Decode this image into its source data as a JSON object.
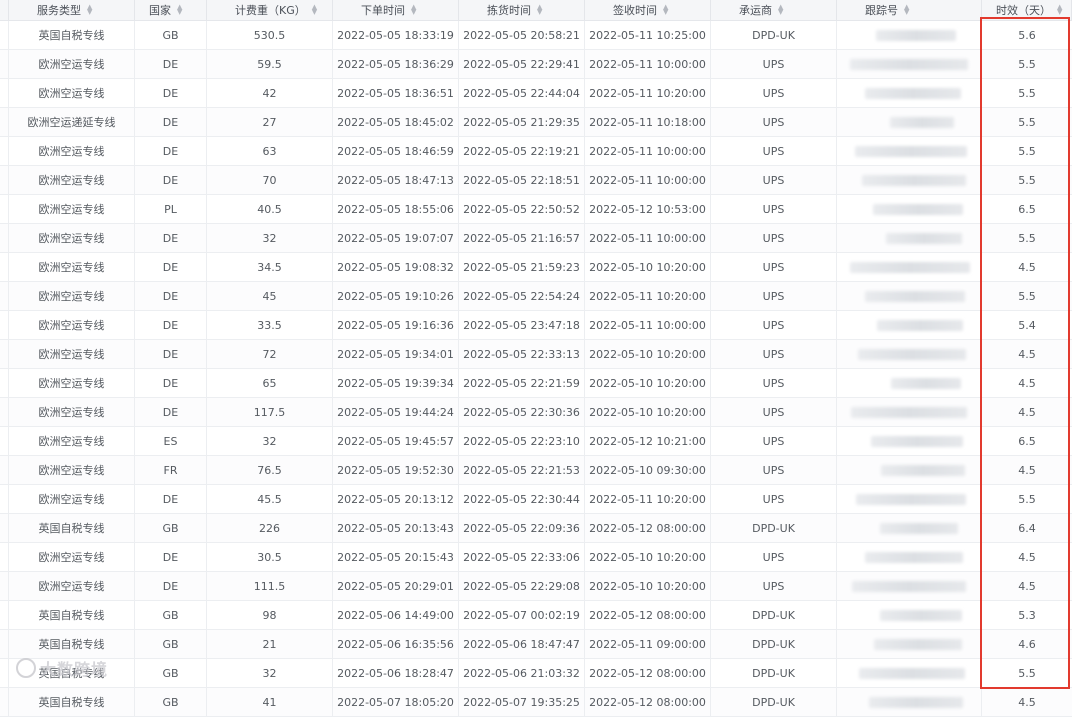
{
  "columns": [
    {
      "label": "服务类型"
    },
    {
      "label": "国家"
    },
    {
      "label": "计费重（KG）"
    },
    {
      "label": "下单时间"
    },
    {
      "label": "拣货时间"
    },
    {
      "label": "签收时间"
    },
    {
      "label": "承运商"
    },
    {
      "label": "跟踪号"
    },
    {
      "label": "时效（天）"
    }
  ],
  "rows": [
    {
      "service": "英国自税专线",
      "country": "GB",
      "weight": "530.5",
      "order_time": "2022-05-05 18:33:19",
      "pick_time": "2022-05-05 20:58:21",
      "sign_time": "2022-05-11 10:25:00",
      "carrier": "DPD-UK",
      "tracking": "",
      "days": "5.6"
    },
    {
      "service": "欧洲空运专线",
      "country": "DE",
      "weight": "59.5",
      "order_time": "2022-05-05 18:36:29",
      "pick_time": "2022-05-05 22:29:41",
      "sign_time": "2022-05-11 10:00:00",
      "carrier": "UPS",
      "tracking": "",
      "days": "5.5"
    },
    {
      "service": "欧洲空运专线",
      "country": "DE",
      "weight": "42",
      "order_time": "2022-05-05 18:36:51",
      "pick_time": "2022-05-05 22:44:04",
      "sign_time": "2022-05-11 10:20:00",
      "carrier": "UPS",
      "tracking": "",
      "days": "5.5"
    },
    {
      "service": "欧洲空运递延专线",
      "country": "DE",
      "weight": "27",
      "order_time": "2022-05-05 18:45:02",
      "pick_time": "2022-05-05 21:29:35",
      "sign_time": "2022-05-11 10:18:00",
      "carrier": "UPS",
      "tracking": "",
      "days": "5.5"
    },
    {
      "service": "欧洲空运专线",
      "country": "DE",
      "weight": "63",
      "order_time": "2022-05-05 18:46:59",
      "pick_time": "2022-05-05 22:19:21",
      "sign_time": "2022-05-11 10:00:00",
      "carrier": "UPS",
      "tracking": "",
      "days": "5.5"
    },
    {
      "service": "欧洲空运专线",
      "country": "DE",
      "weight": "70",
      "order_time": "2022-05-05 18:47:13",
      "pick_time": "2022-05-05 22:18:51",
      "sign_time": "2022-05-11 10:00:00",
      "carrier": "UPS",
      "tracking": "",
      "days": "5.5"
    },
    {
      "service": "欧洲空运专线",
      "country": "PL",
      "weight": "40.5",
      "order_time": "2022-05-05 18:55:06",
      "pick_time": "2022-05-05 22:50:52",
      "sign_time": "2022-05-12 10:53:00",
      "carrier": "UPS",
      "tracking": "",
      "days": "6.5"
    },
    {
      "service": "欧洲空运专线",
      "country": "DE",
      "weight": "32",
      "order_time": "2022-05-05 19:07:07",
      "pick_time": "2022-05-05 21:16:57",
      "sign_time": "2022-05-11 10:00:00",
      "carrier": "UPS",
      "tracking": "",
      "days": "5.5"
    },
    {
      "service": "欧洲空运专线",
      "country": "DE",
      "weight": "34.5",
      "order_time": "2022-05-05 19:08:32",
      "pick_time": "2022-05-05 21:59:23",
      "sign_time": "2022-05-10 10:20:00",
      "carrier": "UPS",
      "tracking": "",
      "days": "4.5"
    },
    {
      "service": "欧洲空运专线",
      "country": "DE",
      "weight": "45",
      "order_time": "2022-05-05 19:10:26",
      "pick_time": "2022-05-05 22:54:24",
      "sign_time": "2022-05-11 10:20:00",
      "carrier": "UPS",
      "tracking": "",
      "days": "5.5"
    },
    {
      "service": "欧洲空运专线",
      "country": "DE",
      "weight": "33.5",
      "order_time": "2022-05-05 19:16:36",
      "pick_time": "2022-05-05 23:47:18",
      "sign_time": "2022-05-11 10:00:00",
      "carrier": "UPS",
      "tracking": "",
      "days": "5.4"
    },
    {
      "service": "欧洲空运专线",
      "country": "DE",
      "weight": "72",
      "order_time": "2022-05-05 19:34:01",
      "pick_time": "2022-05-05 22:33:13",
      "sign_time": "2022-05-10 10:20:00",
      "carrier": "UPS",
      "tracking": "",
      "days": "4.5"
    },
    {
      "service": "欧洲空运专线",
      "country": "DE",
      "weight": "65",
      "order_time": "2022-05-05 19:39:34",
      "pick_time": "2022-05-05 22:21:59",
      "sign_time": "2022-05-10 10:20:00",
      "carrier": "UPS",
      "tracking": "",
      "days": "4.5"
    },
    {
      "service": "欧洲空运专线",
      "country": "DE",
      "weight": "117.5",
      "order_time": "2022-05-05 19:44:24",
      "pick_time": "2022-05-05 22:30:36",
      "sign_time": "2022-05-10 10:20:00",
      "carrier": "UPS",
      "tracking": "",
      "days": "4.5"
    },
    {
      "service": "欧洲空运专线",
      "country": "ES",
      "weight": "32",
      "order_time": "2022-05-05 19:45:57",
      "pick_time": "2022-05-05 22:23:10",
      "sign_time": "2022-05-12 10:21:00",
      "carrier": "UPS",
      "tracking": "",
      "days": "6.5"
    },
    {
      "service": "欧洲空运专线",
      "country": "FR",
      "weight": "76.5",
      "order_time": "2022-05-05 19:52:30",
      "pick_time": "2022-05-05 22:21:53",
      "sign_time": "2022-05-10 09:30:00",
      "carrier": "UPS",
      "tracking": "",
      "days": "4.5"
    },
    {
      "service": "欧洲空运专线",
      "country": "DE",
      "weight": "45.5",
      "order_time": "2022-05-05 20:13:12",
      "pick_time": "2022-05-05 22:30:44",
      "sign_time": "2022-05-11 10:20:00",
      "carrier": "UPS",
      "tracking": "",
      "days": "5.5"
    },
    {
      "service": "英国自税专线",
      "country": "GB",
      "weight": "226",
      "order_time": "2022-05-05 20:13:43",
      "pick_time": "2022-05-05 22:09:36",
      "sign_time": "2022-05-12 08:00:00",
      "carrier": "DPD-UK",
      "tracking": "",
      "days": "6.4"
    },
    {
      "service": "欧洲空运专线",
      "country": "DE",
      "weight": "30.5",
      "order_time": "2022-05-05 20:15:43",
      "pick_time": "2022-05-05 22:33:06",
      "sign_time": "2022-05-10 10:20:00",
      "carrier": "UPS",
      "tracking": "",
      "days": "4.5"
    },
    {
      "service": "欧洲空运专线",
      "country": "DE",
      "weight": "111.5",
      "order_time": "2022-05-05 20:29:01",
      "pick_time": "2022-05-05 22:29:08",
      "sign_time": "2022-05-10 10:20:00",
      "carrier": "UPS",
      "tracking": "",
      "days": "4.5"
    },
    {
      "service": "英国自税专线",
      "country": "GB",
      "weight": "98",
      "order_time": "2022-05-06 14:49:00",
      "pick_time": "2022-05-07 00:02:19",
      "sign_time": "2022-05-12 08:00:00",
      "carrier": "DPD-UK",
      "tracking": "",
      "days": "5.3"
    },
    {
      "service": "英国自税专线",
      "country": "GB",
      "weight": "21",
      "order_time": "2022-05-06 16:35:56",
      "pick_time": "2022-05-06 18:47:47",
      "sign_time": "2022-05-11 09:00:00",
      "carrier": "DPD-UK",
      "tracking": "",
      "days": "4.6"
    },
    {
      "service": "英国自税专线",
      "country": "GB",
      "weight": "32",
      "order_time": "2022-05-06 18:28:47",
      "pick_time": "2022-05-06 21:03:32",
      "sign_time": "2022-05-12 08:00:00",
      "carrier": "DPD-UK",
      "tracking": "",
      "days": "5.5"
    },
    {
      "service": "英国自税专线",
      "country": "GB",
      "weight": "41",
      "order_time": "2022-05-07 18:05:20",
      "pick_time": "2022-05-07 19:35:25",
      "sign_time": "2022-05-12 08:00:00",
      "carrier": "DPD-UK",
      "tracking": "",
      "days": "4.5"
    }
  ],
  "watermark": "大数跨境"
}
